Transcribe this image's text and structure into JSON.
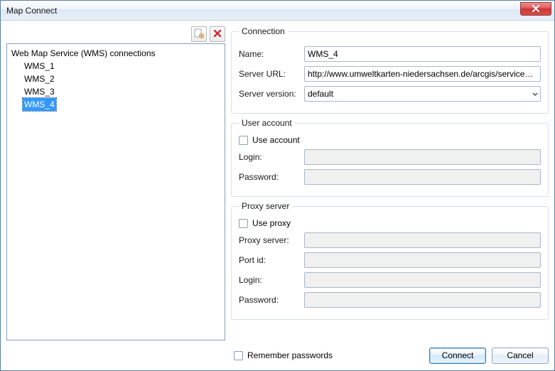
{
  "window": {
    "title": "Map Connect"
  },
  "tree": {
    "root_label": "Web Map Service (WMS) connections",
    "items": [
      {
        "label": "WMS_1",
        "selected": false
      },
      {
        "label": "WMS_2",
        "selected": false
      },
      {
        "label": "WMS_3",
        "selected": false
      },
      {
        "label": "WMS_4",
        "selected": true
      }
    ]
  },
  "connection": {
    "legend": "Connection",
    "name_label": "Name:",
    "name_value": "WMS_4",
    "url_label": "Server URL:",
    "url_value": "http://www.umweltkarten-niedersachsen.de/arcgis/services/Basisd",
    "version_label": "Server version:",
    "version_value": "default"
  },
  "user": {
    "legend": "User account",
    "use_label": "Use account",
    "use_checked": false,
    "login_label": "Login:",
    "login_value": "",
    "password_label": "Password:",
    "password_value": ""
  },
  "proxy": {
    "legend": "Proxy server",
    "use_label": "Use proxy",
    "use_checked": false,
    "server_label": "Proxy server:",
    "server_value": "",
    "port_label": "Port id:",
    "port_value": "",
    "login_label": "Login:",
    "login_value": "",
    "password_label": "Password:",
    "password_value": ""
  },
  "footer": {
    "remember_label": "Remember passwords",
    "remember_checked": false,
    "connect_label": "Connect",
    "cancel_label": "Cancel"
  },
  "icons": {
    "add": "add-connection-icon",
    "delete": "delete-connection-icon",
    "close": "close-icon",
    "caret": "chevron-down-icon"
  }
}
